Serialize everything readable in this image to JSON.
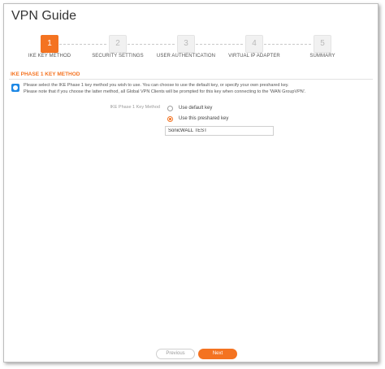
{
  "window": {
    "title": "VPN Guide"
  },
  "wizard": {
    "steps": [
      {
        "number": "1",
        "label": "IKE KEY METHOD",
        "active": true
      },
      {
        "number": "2",
        "label": "SECURITY SETTINGS",
        "active": false
      },
      {
        "number": "3",
        "label": "USER AUTHENTICATION",
        "active": false
      },
      {
        "number": "4",
        "label": "VIRTUAL IP ADAPTER",
        "active": false
      },
      {
        "number": "5",
        "label": "SUMMARY",
        "active": false
      }
    ]
  },
  "section": {
    "title": "IKE PHASE 1 KEY METHOD",
    "info_icon": "info-icon",
    "info_line1": "Please select the IKE Phase 1 key method you wish to use. You can choose to use the default key, or specify your own preshared key.",
    "info_line2": "Please note that if you choose the latter method, all Global VPN Clients will be prompted for this key when connecting to the 'WAN GroupVPN'."
  },
  "form": {
    "label": "IKE Phase 1 Key Method",
    "options": [
      {
        "label": "Use default key",
        "selected": false
      },
      {
        "label": "Use this preshared key",
        "selected": true
      }
    ],
    "preshared_key_value": "SonicWALL TEST"
  },
  "footer": {
    "previous_label": "Previous",
    "next_label": "Next"
  },
  "colors": {
    "accent": "#f47321",
    "info": "#1e88e5"
  }
}
